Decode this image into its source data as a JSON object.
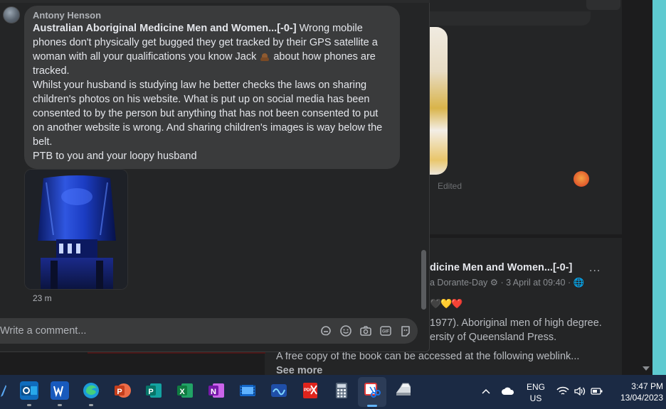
{
  "comment": {
    "author": "Antony Henson",
    "tag": "Australian Aboriginal Medicine Men and Women...[-0-]",
    "line1_after_tag": " Wrong mobile phones don't physically get bugged they get tracked by their GPS satellite a woman with all your qualifications you know Jack ",
    "line1_end": " about how phones are tracked.",
    "paragraph2": "Whilst your husband is studying law he better checks the laws on sharing children's photos on his website. What is put up on social media has been consented to by the person but anything that has not been consented to put on another website is wrong. And sharing children's images is way below the belt.",
    "paragraph3": "PTB to you and your loopy husband",
    "timestamp": "23 m"
  },
  "composer": {
    "placeholder": "Write a comment...",
    "icons": [
      "sticker-icon",
      "emoji-icon",
      "camera-icon",
      "gif-icon",
      "avatar-sticker-icon"
    ]
  },
  "background_post": {
    "edited_label": "Edited",
    "title": "dicine Men and Women...[-0-]",
    "more": "...",
    "meta": "a Dorante-Day ⚙ · 3 April at 09:40 · 🌐",
    "hearts": "🖤💛❤️",
    "line1": "1977). Aboriginal men of high degree.",
    "line2": "ersity of Queensland Press.",
    "line3": "A free copy of the book can be accessed at the following weblink...",
    "see_more": "See more"
  },
  "taskbar": {
    "apps": [
      "outlook-icon",
      "word-icon",
      "edge-icon",
      "powerpoint-icon",
      "publisher-icon",
      "excel-icon",
      "onenote-icon",
      "video-editor-icon",
      "whiteboard-icon",
      "pdf-icon",
      "calculator-icon",
      "snipping-tool-icon",
      "scanner-icon"
    ],
    "lang_top": "ENG",
    "lang_bottom": "US",
    "time": "3:47 PM",
    "date": "13/04/2023"
  },
  "colors": {
    "panel": "#242526",
    "bubble": "#3a3b3c",
    "taskbar": "#1b2a44",
    "accent_edge": "#5ecad0"
  }
}
